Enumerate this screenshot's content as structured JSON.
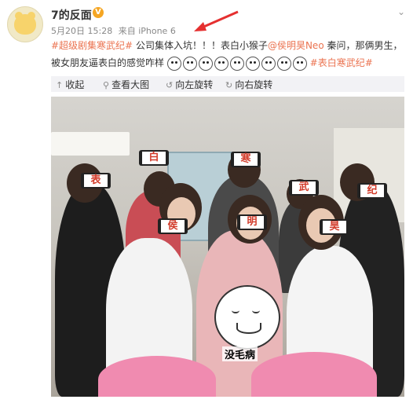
{
  "post": {
    "username": "7的反面",
    "verified_badge": "V",
    "date": "5月20日 15:28",
    "source": "来自 iPhone 6",
    "text_tag1": "#超级剧集寒武纪#",
    "text_1": " 公司集体入坑！！！表白小猴子",
    "text_mention": "@侯明昊Neo",
    "text_2": " 秦问，那俩男生，被女朋友逼表白的感觉咋样",
    "text_tag2": "#表白寒武纪#"
  },
  "toolbar": {
    "collapse": "收起",
    "view_large": "查看大图",
    "rotate_left": "向左旋转",
    "rotate_right": "向右旋转"
  },
  "photo": {
    "signs": [
      "白",
      "寒",
      "表",
      "武",
      "纪",
      "侯",
      "明",
      "昊"
    ],
    "meme_caption": "没毛病"
  },
  "colors": {
    "accent": "#eb7350",
    "toolbar_bg": "#f2f2f5",
    "sign_text": "#d23b2a"
  },
  "icons": [
    "avatar",
    "verified-badge-icon",
    "chevron-down-icon",
    "arrow-annotation-icon",
    "emoji-icon",
    "collapse-icon",
    "zoom-icon",
    "rotate-left-icon",
    "rotate-right-icon"
  ]
}
